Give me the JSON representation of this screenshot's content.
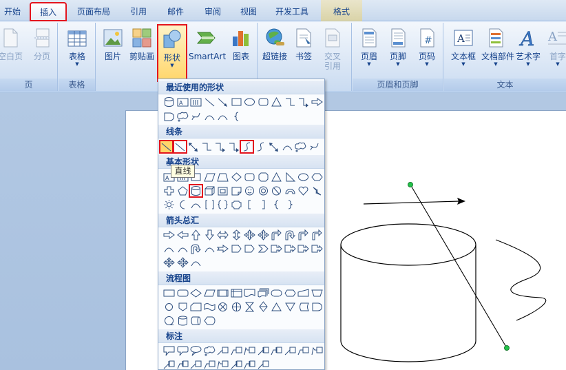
{
  "tabs": [
    {
      "label": "开始"
    },
    {
      "label": "插入"
    },
    {
      "label": "页面布局"
    },
    {
      "label": "引用"
    },
    {
      "label": "邮件"
    },
    {
      "label": "审阅"
    },
    {
      "label": "视图"
    },
    {
      "label": "开发工具"
    },
    {
      "label": "格式"
    }
  ],
  "ribbon": {
    "pages_group": {
      "label": "页",
      "blank_page": "空白页",
      "page_break": "分页"
    },
    "table_group": {
      "label": "表格",
      "table": "表格"
    },
    "illustrations_group": {
      "picture": "图片",
      "clipart": "剪贴画",
      "shapes": "形状",
      "smartart": "SmartArt",
      "chart": "图表"
    },
    "links_group": {
      "hyperlink": "超链接",
      "bookmark": "书签",
      "cross_ref_1": "交叉",
      "cross_ref_2": "引用"
    },
    "header_footer_group": {
      "label": "页眉和页脚",
      "header": "页眉",
      "footer": "页脚",
      "page_number": "页码"
    },
    "text_group": {
      "label": "文本",
      "textbox": "文本框",
      "quickparts": "文档部件",
      "wordart": "艺术字",
      "dropcap": "首字"
    }
  },
  "dropdown": {
    "categories": [
      "最近使用的形状",
      "线条",
      "基本形状",
      "箭头总汇",
      "流程图",
      "标注"
    ],
    "tooltip": "直线"
  },
  "icons": {
    "selected_highlight": "#e3141e",
    "accent": "#15428b",
    "handle_color": "#22c24a"
  }
}
